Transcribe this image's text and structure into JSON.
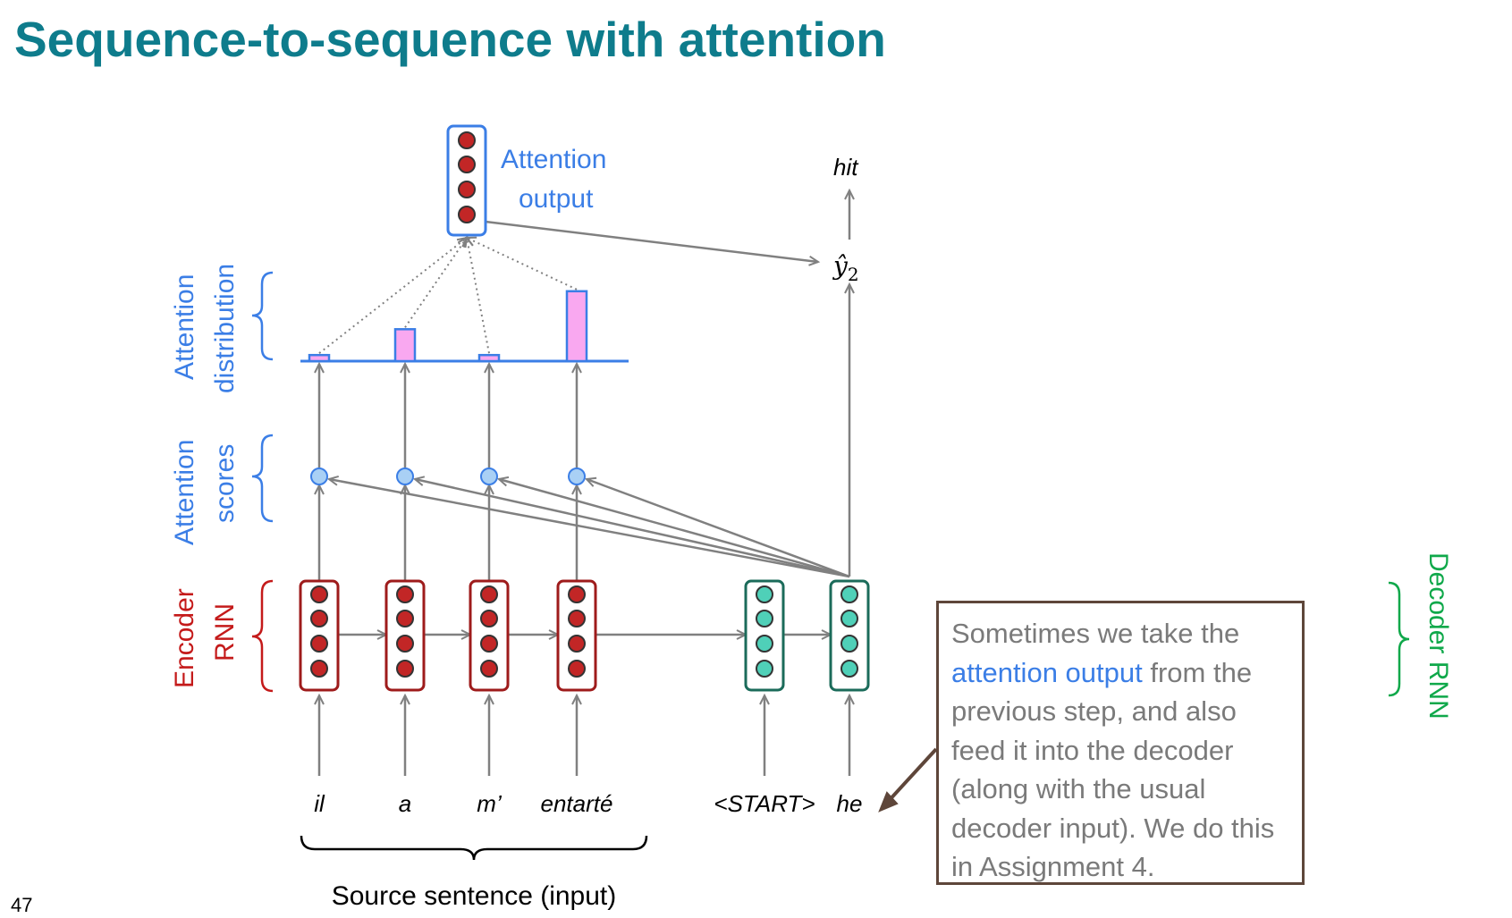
{
  "title": "Sequence-to-sequence with attention",
  "page_number": "47",
  "labels": {
    "attention_output_line1": "Attention",
    "attention_output_line2": "output",
    "attention_distribution_line1": "Attention",
    "attention_distribution_line2": "distribution",
    "attention_scores_line1": "Attention",
    "attention_scores_line2": "scores",
    "encoder_line1": "Encoder",
    "encoder_line2": "RNN",
    "decoder": "Decoder RNN",
    "output_word": "hit",
    "y_hat": "ŷ",
    "y_hat_sub": "2",
    "source_caption": "Source sentence (input)"
  },
  "source_words": [
    "il",
    "a",
    "m’",
    "entarté"
  ],
  "decoder_words": [
    "<START>",
    "he"
  ],
  "attention_weights": [
    0.08,
    0.42,
    0.08,
    0.92
  ],
  "note": {
    "part1": "Sometimes we take the ",
    "highlight": "attention output",
    "part2": " from the previous step, and also feed it into the decoder (along with the usual decoder input). We do this in Assignment 4."
  },
  "colors": {
    "title": "#0e7c8c",
    "blue": "#3b7ee6",
    "encoder": "#9e1b1b",
    "decoder": "#1b6b5a",
    "green_label": "#0fa84a",
    "bar_fill": "#f9a8f0",
    "score_fill": "#a9d0f5",
    "arrow": "#808080"
  }
}
